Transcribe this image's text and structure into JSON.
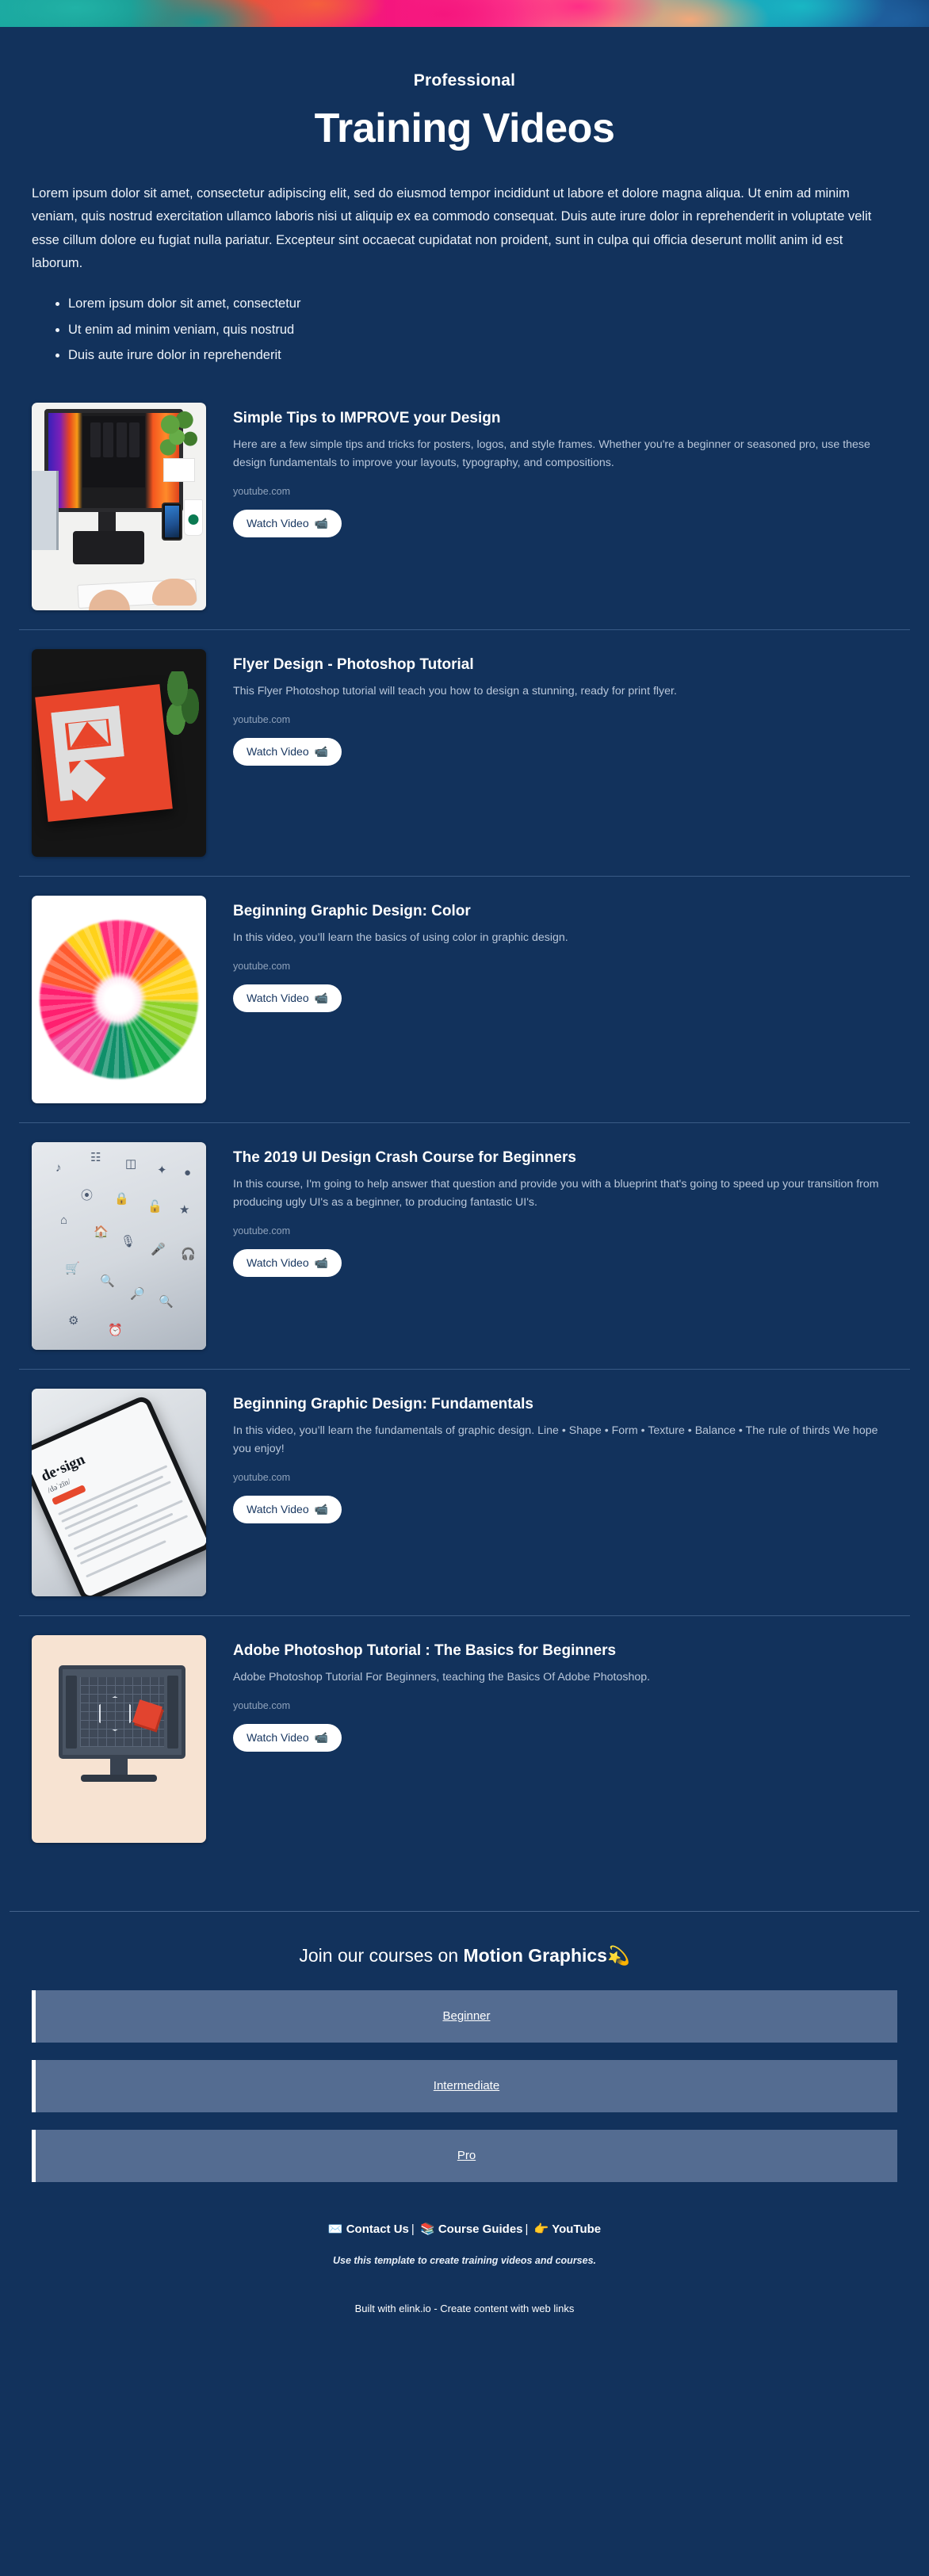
{
  "header": {
    "kicker": "Professional",
    "title": "Training Videos",
    "intro": "Lorem ipsum dolor sit amet, consectetur adipiscing elit, sed do eiusmod tempor incididunt ut labore et dolore magna aliqua. Ut enim ad minim veniam, quis nostrud exercitation ullamco laboris nisi ut aliquip ex ea commodo consequat. Duis aute irure dolor in reprehenderit in voluptate velit esse cillum dolore eu fugiat nulla pariatur. Excepteur sint occaecat cupidatat non proident, sunt in culpa qui officia deserunt mollit anim id est laborum.",
    "bullets": [
      "Lorem ipsum dolor sit amet, consectetur",
      "Ut enim ad minim veniam, quis nostrud",
      "Duis aute irure dolor in reprehenderit"
    ]
  },
  "cards": [
    {
      "title": "Simple Tips to IMPROVE your Design",
      "desc": "Here are a few simple tips and tricks for posters, logos, and style frames. Whether you're a beginner or seasoned pro, use these design fundamentals to improve your layouts, typography, and compositions.",
      "source": "youtube.com",
      "button": "Watch Video",
      "button_emoji": "📹",
      "thumb_alt": "desktop-monitor-workspace-photo"
    },
    {
      "title": "Flyer Design - Photoshop Tutorial",
      "desc": "This Flyer Photoshop tutorial will teach you how to design a stunning, ready for print flyer.",
      "source": "youtube.com",
      "button": "Watch Video",
      "button_emoji": "📹",
      "thumb_alt": "red-flyer-design-photo"
    },
    {
      "title": "Beginning Graphic Design: Color",
      "desc": "In this video, you’ll learn the basics of using color in graphic design.",
      "source": "youtube.com",
      "button": "Watch Video",
      "button_emoji": "📹",
      "thumb_alt": "rainbow-flower-photo"
    },
    {
      "title": "The 2019 UI Design Crash Course for Beginners",
      "desc": "In this course, I'm going to help answer that question and provide you with a blueprint that's going to speed up your transition from producing ugly UI's as a beginner, to producing fantastic UI's.",
      "source": "youtube.com",
      "button": "Watch Video",
      "button_emoji": "📹",
      "thumb_alt": "icon-sheet-photo"
    },
    {
      "title": "Beginning Graphic Design: Fundamentals",
      "desc": "In this video, you’ll learn the fundamentals of graphic design. Line • Shape • Form • Texture • Balance • The rule of thirds We hope you enjoy!",
      "source": "youtube.com",
      "button": "Watch Video",
      "button_emoji": "📹",
      "thumb_alt": "dictionary-design-phone-photo"
    },
    {
      "title": "Adobe Photoshop Tutorial : The Basics for Beginners",
      "desc": "Adobe Photoshop Tutorial For Beginners, teaching the Basics Of Adobe Photoshop.",
      "source": "youtube.com",
      "button": "Watch Video",
      "button_emoji": "📹",
      "thumb_alt": "photoshop-workspace-illustration"
    }
  ],
  "cta": {
    "title_plain": "Join our courses on ",
    "title_bold": "Motion Graphics",
    "title_emoji": "💫",
    "items": [
      {
        "label": "Beginner"
      },
      {
        "label": "Intermediate"
      },
      {
        "label": "Pro"
      }
    ]
  },
  "footer": {
    "links": [
      {
        "emoji": "✉️",
        "label": "Contact Us"
      },
      {
        "emoji": "📚",
        "label": "Course Guides"
      },
      {
        "emoji": "👉",
        "label": "YouTube"
      }
    ],
    "separator": "|",
    "tagline": "Use this template to create training videos and courses.",
    "built_with": "Built with elink.io - Create content with web links"
  },
  "colors": {
    "background": "#12325c",
    "cta_button": "#546c91",
    "divider": "#41628c",
    "text_primary": "#ffffff",
    "text_muted": "#b9c7da"
  }
}
